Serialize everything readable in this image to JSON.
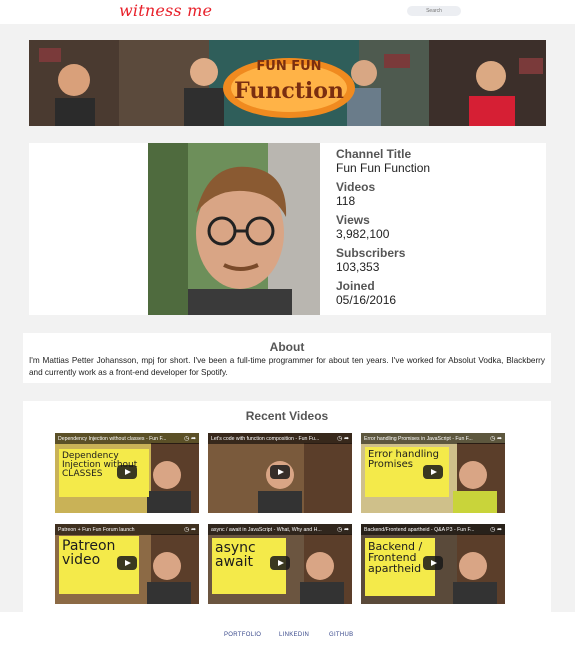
{
  "header": {
    "logo_text": "witness me",
    "search_placeholder": "Search"
  },
  "banner": {
    "logo_top": "FUN FUN",
    "logo_main": "Function"
  },
  "channel": {
    "title_label": "Channel Title",
    "title_value": "Fun Fun Function",
    "videos_label": "Videos",
    "videos_value": "118",
    "views_label": "Views",
    "views_value": "3,982,100",
    "subscribers_label": "Subscribers",
    "subscribers_value": "103,353",
    "joined_label": "Joined",
    "joined_value": "05/16/2016"
  },
  "about": {
    "heading": "About",
    "text": "I'm Mattias Petter Johansson, mpj for short. I've been a full-time programmer for about ten years. I've worked for Absolut Vodka, Blackberry and currently work as a front-end developer for Spotify."
  },
  "recent_videos": {
    "heading": "Recent Videos",
    "items": [
      {
        "title": "Dependency Injection without classes - Fun F...",
        "note": "Dependency Injection without CLASSES",
        "bg": "#c9b257"
      },
      {
        "title": "Let's code with function composition - Fun Fu...",
        "note": "",
        "bg": "#7a5a3c"
      },
      {
        "title": "Error handling Promises in JavaScript - Fun F...",
        "note": "Error handling Promises",
        "bg": "#cfc08a"
      },
      {
        "title": "Patreon + Fun Fun Forum launch",
        "note": "Patreon video",
        "bg": "#8c6a45"
      },
      {
        "title": "async / await in JavaScript - What, Why and H...",
        "note": "async await",
        "bg": "#6b5540"
      },
      {
        "title": "Backend/Frontend apartheid - Q&A P3 - Fun F...",
        "note": "Backend / Frontend apartheid",
        "bg": "#5a4a3a"
      }
    ]
  },
  "footer": {
    "portfolio": "PORTFOLIO",
    "linkedin": "LINKEDIN",
    "github": "GITHUB"
  },
  "colors": {
    "logo": "#e8202a",
    "link": "#3a4a8c",
    "note_yellow": "#f4ea4a"
  }
}
